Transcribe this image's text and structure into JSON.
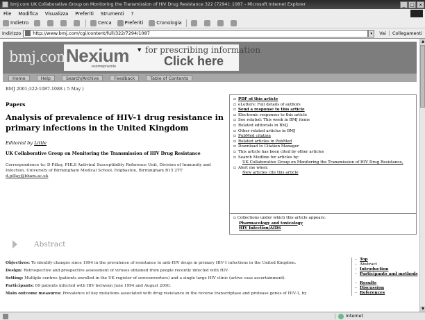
{
  "window": {
    "title": "bmj.com UK Collaborative Group on Monitoring the Transmission of HIV Drug Resistance 322 (7294): 1087 - Microsoft Internet Explorer",
    "controls": [
      "_",
      "□",
      "×"
    ]
  },
  "menu": [
    "File",
    "Modifica",
    "Visualizza",
    "Preferiti",
    "Strumenti",
    "?"
  ],
  "toolbar": {
    "back": "Indietro",
    "search": "Cerca",
    "favorites": "Preferiti",
    "history": "Cronologia"
  },
  "address": {
    "label": "Indirizzo",
    "url": "http://www.bmj.com/cgi/content/full/322/7294/1087",
    "go": "Vai",
    "links": "Collegamenti"
  },
  "bmj": {
    "logo": "bmj.com",
    "ad": {
      "brand": "Nexium",
      "sub": "esomeprazole",
      "line1": "for prescribing information",
      "line2": "Click here"
    },
    "nav": [
      "Home",
      "Help",
      "Search/Archive",
      "Feedback",
      "Table of Contents"
    ]
  },
  "article": {
    "citation": "BMJ 2001;322:1087-1088 ( 5 May )",
    "section": "Papers",
    "title": "Analysis of prevalence of HIV-1 drug resistance in primary infections in the United Kingdom",
    "editorial_prefix": "Editorial by ",
    "editorial_link": "Little",
    "authors": "UK Collaborative Group on Monitoring the Transmission of HIV Drug Resistance",
    "correspondence": "Correspondence to: D Pillay, PHLS Antiviral Susceptibility Reference Unit, Division of Immunity and Infection, University of Birmingham Medical School, Edgbaston, Birmingham B15 2TT",
    "email": "d.pillay@bham.ac.uk"
  },
  "sidebox": {
    "links": [
      "PDF of this article",
      "eLetters: Full details of authors",
      "Send a response to this article",
      "Electronic responses to this article",
      "See related: This week in BMJ items",
      "Related editorials in BMJ",
      "Other related articles in BMJ",
      "PubMed citation",
      "Related articles in PubMed",
      "Download to Citation Manager",
      "This article has been cited by other articles",
      "Search Medline for articles by:",
      "UK Collaborative Group on Monitoring the Transmission of HIV Drug Resistance,",
      "Alert me when:",
      "New articles cite this article"
    ],
    "collections_label": "Collections under which this article appears:",
    "collections": [
      "Pharmacology and toxicology",
      "HIV Infection/AIDS"
    ]
  },
  "abstract": {
    "heading": "Abstract",
    "paragraphs": [
      {
        "label": "Objectives:",
        "text": "To identify changes since 1994 in the prevalence of resistance to anti-HIV drugs in primary HIV-1 infections in the United Kingdom."
      },
      {
        "label": "Design:",
        "text": "Retrospective and prospective assessment of viruses obtained from people recently infected with HIV."
      },
      {
        "label": "Setting:",
        "text": "Multiple centres (patients enrolled in the UK register of seroconverters) and a single large HIV clinic (active case ascertainment)."
      },
      {
        "label": "Participants:",
        "text": "69 patients infected with HIV between June 1994 and August 2000."
      },
      {
        "label": "Main outcome measures:",
        "text": "Prevalence of key mutations associated with drug resistance in the reverse transcriptase and protease genes of HIV-1, by"
      }
    ]
  },
  "toc": [
    {
      "label": "Top",
      "link": true
    },
    {
      "label": "Abstract",
      "link": false
    },
    {
      "label": "Introduction",
      "link": true
    },
    {
      "label": "Participants and methods",
      "link": true
    },
    {
      "label": "Results",
      "link": true
    },
    {
      "label": "Discussion",
      "link": true
    },
    {
      "label": "References",
      "link": true
    }
  ],
  "status": {
    "zone": "Internet"
  }
}
